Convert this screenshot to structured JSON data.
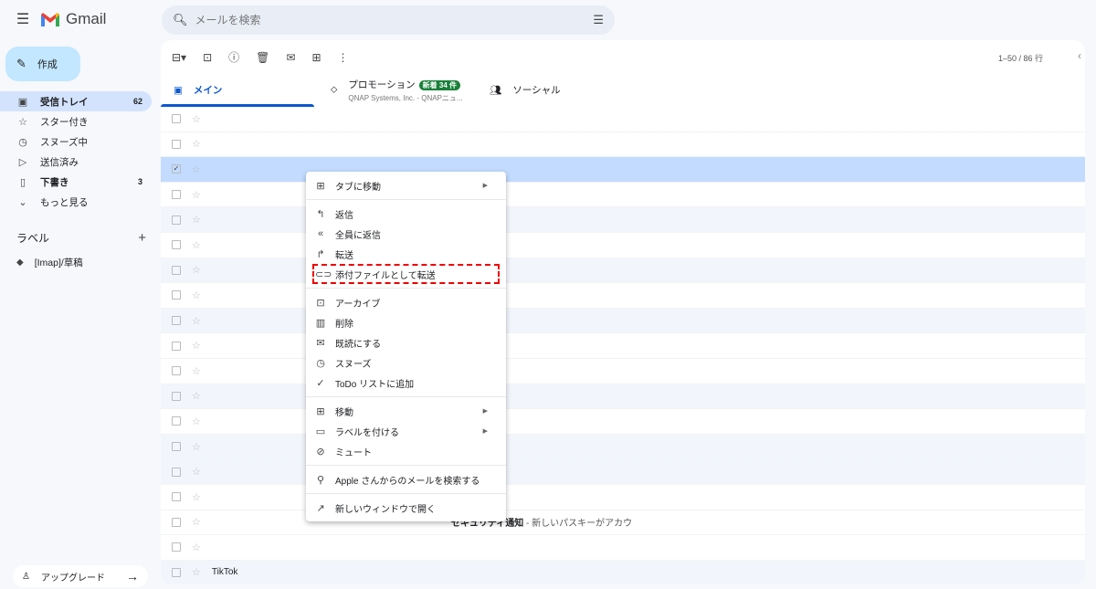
{
  "app": {
    "name": "Gmail",
    "brand_color": "#ea4335"
  },
  "search": {
    "placeholder": "メールを検索"
  },
  "compose": {
    "label": "作成"
  },
  "sidebar": {
    "items": [
      {
        "label": "受信トレイ",
        "count": "62",
        "icon": "inbox-icon"
      },
      {
        "label": "スター付き",
        "count": "",
        "icon": "star-icon"
      },
      {
        "label": "スヌーズ中",
        "count": "",
        "icon": "clock-icon"
      },
      {
        "label": "送信済み",
        "count": "",
        "icon": "send-icon"
      },
      {
        "label": "下書き",
        "count": "3",
        "icon": "draft-icon"
      },
      {
        "label": "もっと見る",
        "count": "",
        "icon": "chevron-down-icon"
      }
    ],
    "labels_title": "ラベル",
    "labels": [
      {
        "label": "[Imap]/草稿"
      }
    ],
    "upgrade": "アップグレード"
  },
  "pager": {
    "text": "1–50 / 86 行"
  },
  "tabs": [
    {
      "label": "メイン"
    },
    {
      "label": "プロモーション",
      "badge": "新着 34 件",
      "sub": "QNAP Systems, Inc. - QNAPニュ..."
    },
    {
      "label": "ソーシャル"
    }
  ],
  "rows": [
    {
      "sender": "",
      "subject": "",
      "read": false
    },
    {
      "sender": "",
      "subject": "",
      "read": false
    },
    {
      "sender": "",
      "subject": "",
      "read": false,
      "selected": true
    },
    {
      "sender": "",
      "subject": "",
      "read": false
    },
    {
      "sender": "",
      "subject": "",
      "read": true
    },
    {
      "sender": "",
      "subject": "",
      "read": false
    },
    {
      "sender": "",
      "subject": "",
      "read": true
    },
    {
      "sender": "",
      "subject": "",
      "read": false
    },
    {
      "sender": "",
      "subject": "",
      "read": true
    },
    {
      "sender": "",
      "subject": "",
      "read": false
    },
    {
      "sender": "",
      "subject": "",
      "read": false
    },
    {
      "sender": "",
      "subject": "",
      "read": true
    },
    {
      "sender": "",
      "subject": "",
      "read": false
    },
    {
      "sender": "",
      "subject": "",
      "read": true
    },
    {
      "sender": "",
      "subject": "",
      "read": true
    },
    {
      "sender": "",
      "subject": "",
      "read": false
    },
    {
      "sender": "",
      "subject": "セキュリティ通知",
      "snippet": " - 新しいパスキーがアカウ",
      "read": false
    },
    {
      "sender": "",
      "subject": "",
      "read": false
    },
    {
      "sender": "TikTok",
      "subject": "",
      "read": true
    }
  ],
  "context_menu": {
    "groups": [
      [
        {
          "label": "タブに移動",
          "icon": "folder-move-icon",
          "submenu": true
        }
      ],
      [
        {
          "label": "返信",
          "icon": "reply-icon"
        },
        {
          "label": "全員に返信",
          "icon": "reply-all-icon"
        },
        {
          "label": "転送",
          "icon": "forward-icon"
        },
        {
          "label": "添付ファイルとして転送",
          "icon": "attachment-icon",
          "highlighted": true
        }
      ],
      [
        {
          "label": "アーカイブ",
          "icon": "archive-icon"
        },
        {
          "label": "削除",
          "icon": "trash-icon"
        },
        {
          "label": "既読にする",
          "icon": "mail-open-icon"
        },
        {
          "label": "スヌーズ",
          "icon": "clock-icon"
        },
        {
          "label": "ToDo リストに追加",
          "icon": "add-task-icon"
        }
      ],
      [
        {
          "label": "移動",
          "icon": "folder-move-icon",
          "submenu": true
        },
        {
          "label": "ラベルを付ける",
          "icon": "label-icon",
          "submenu": true
        },
        {
          "label": "ミュート",
          "icon": "mute-icon"
        }
      ],
      [
        {
          "label": "Apple さんからのメールを検索する",
          "icon": "search-icon"
        }
      ],
      [
        {
          "label": "新しいウィンドウで開く",
          "icon": "open-in-new-icon"
        }
      ]
    ],
    "highlight_color": "#e00000"
  }
}
